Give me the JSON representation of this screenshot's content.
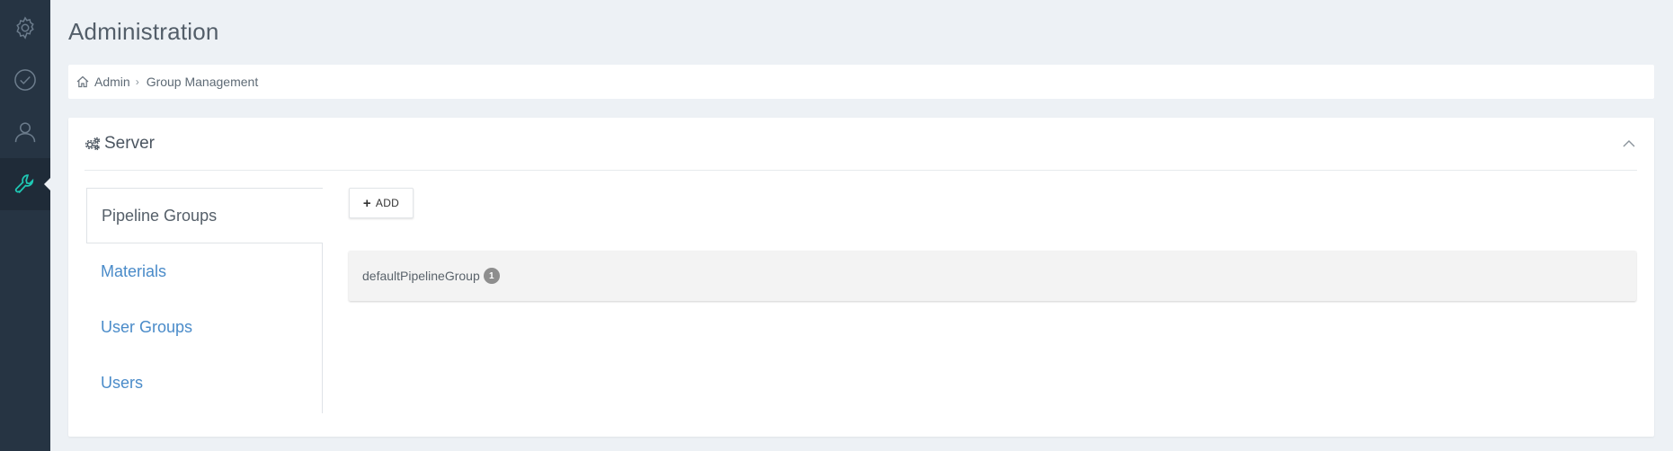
{
  "sidebar": {
    "items": [
      {
        "icon": "gear-icon",
        "active": false
      },
      {
        "icon": "check-circle-icon",
        "active": false
      },
      {
        "icon": "user-icon",
        "active": false
      },
      {
        "icon": "wrench-icon",
        "active": true
      }
    ],
    "colors": {
      "background": "#263443",
      "icon": "#6c7c8c",
      "active_icon": "#1fc8b4"
    }
  },
  "header": {
    "title": "Administration"
  },
  "breadcrumb": {
    "items": [
      "Admin",
      "Group Management"
    ]
  },
  "panel": {
    "title": "Server",
    "tabs": [
      {
        "label": "Pipeline Groups",
        "active": true
      },
      {
        "label": "Materials",
        "active": false
      },
      {
        "label": "User Groups",
        "active": false
      },
      {
        "label": "Users",
        "active": false
      }
    ],
    "add_label": "ADD",
    "groups": [
      {
        "name": "defaultPipelineGroup",
        "count": "1"
      }
    ]
  },
  "colors": {
    "link": "#4a8bc9",
    "page_background": "#edf1f5"
  }
}
